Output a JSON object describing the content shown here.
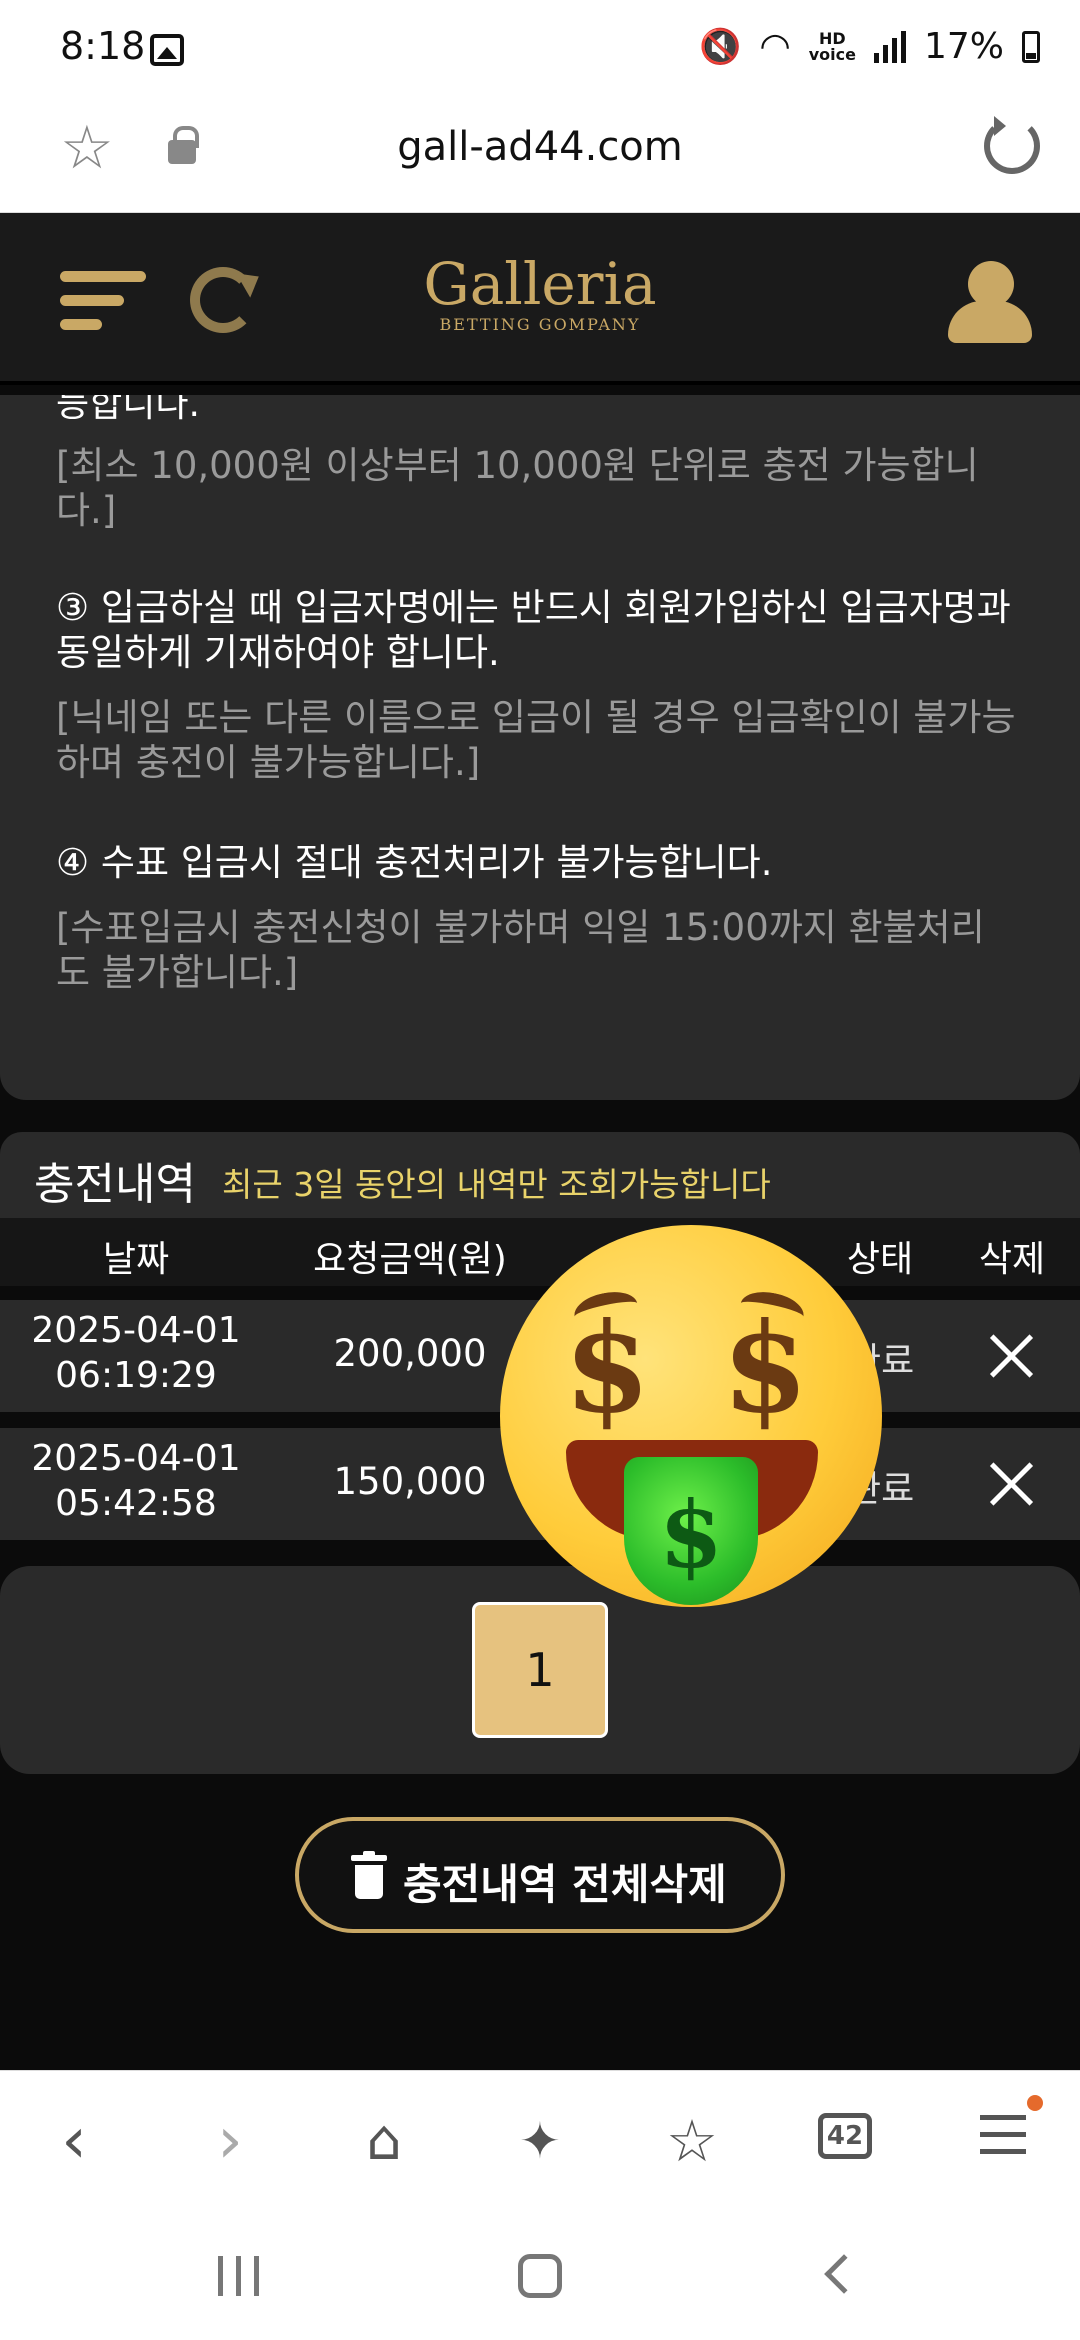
{
  "status_bar": {
    "time": "8:18",
    "battery": "17%",
    "hd_label": "HD\nvoice"
  },
  "browser": {
    "url": "gall-ad44.com"
  },
  "site": {
    "logo_main": "Galleria",
    "logo_sub": "BETTING GOMPANY"
  },
  "notice": {
    "cut_line": "능합니다.",
    "rule2_note": "[최소 10,000원 이상부터 10,000원 단위로 충전 가능합니다.]",
    "rule3": "③ 입금하실 때 입금자명에는 반드시 회원가입하신 입금자명과 동일하게 기재하여야 합니다.",
    "rule3_note": "[닉네임 또는 다른 이름으로 입금이 될 경우 입금확인이 불가능하며 충전이 불가능합니다.]",
    "rule4": "④ 수표 입금시 절대 충전처리가 불가능합니다.",
    "rule4_note": "[수표입금시 충전신청이 불가하며 익일 15:00까지 환불처리도 불가합니다.]"
  },
  "history": {
    "title": "충전내역",
    "subtitle": "최근 3일 동안의 내역만 조회가능합니다",
    "columns": {
      "date": "날짜",
      "amount": "요청금액(원)",
      "status": "상태",
      "delete": "삭제"
    },
    "rows": [
      {
        "date": "2025-04-01",
        "time": "06:19:29",
        "amount": "200,000",
        "status": "완료"
      },
      {
        "date": "2025-04-01",
        "time": "05:42:58",
        "amount": "150,000",
        "status": "완료"
      }
    ]
  },
  "pagination": {
    "current_page": "1"
  },
  "delete_all": {
    "label": "충전내역 전체삭제"
  },
  "nav": {
    "tabs_count": "42"
  },
  "emoji": {
    "name": "money-mouth-face"
  },
  "colors": {
    "gold": "#c9a865",
    "background": "#0b0b0b",
    "card": "#2a2a2a",
    "subtitle_yellow": "#e9d36a",
    "page_button": "#e6c27f"
  }
}
